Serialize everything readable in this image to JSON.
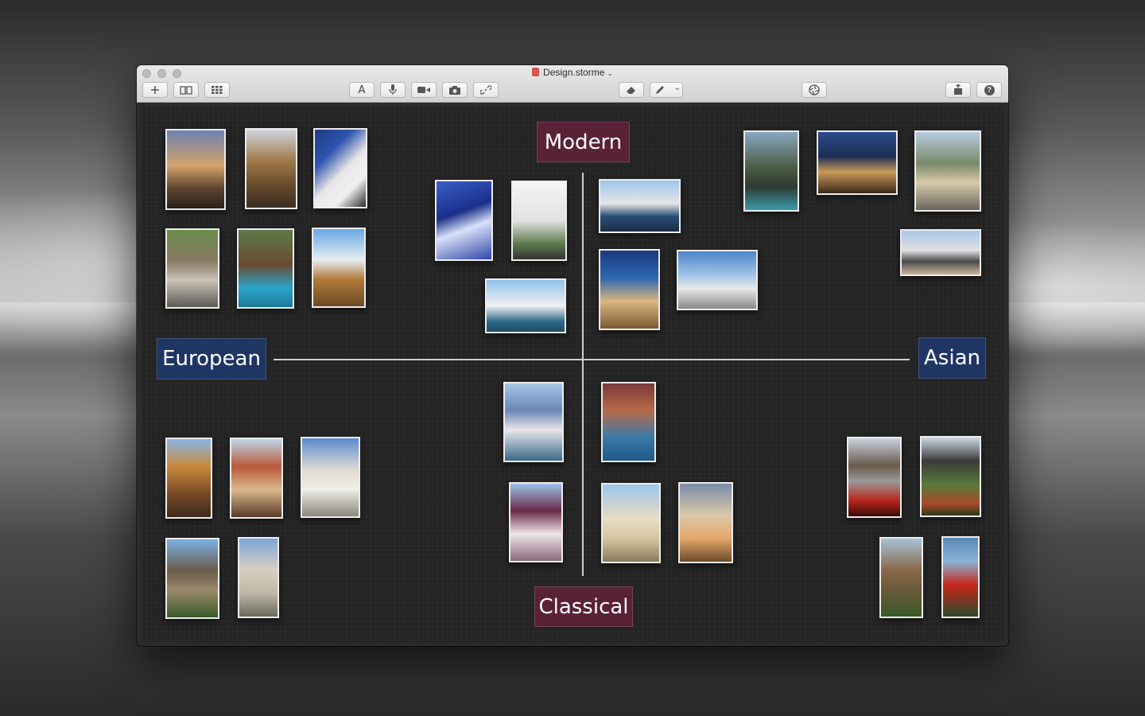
{
  "window": {
    "title": "Design.storme"
  },
  "toolbar": {
    "left": [
      {
        "name": "add-icon",
        "glyph": "+"
      },
      {
        "name": "book-icon",
        "glyph": ""
      },
      {
        "name": "grid-icon",
        "glyph": ""
      }
    ],
    "center": [
      {
        "name": "text-icon",
        "glyph": "A"
      },
      {
        "name": "microphone-icon",
        "glyph": ""
      },
      {
        "name": "video-icon",
        "glyph": ""
      },
      {
        "name": "camera-icon",
        "glyph": ""
      },
      {
        "name": "link-icon",
        "glyph": ""
      }
    ],
    "draw": [
      {
        "name": "eraser-icon"
      },
      {
        "name": "pencil-icon"
      },
      {
        "name": "chevron-down-icon"
      }
    ],
    "right": [
      {
        "name": "aperture-icon"
      },
      {
        "name": "share-icon"
      },
      {
        "name": "help-icon",
        "glyph": "?"
      }
    ]
  },
  "labels": {
    "modern": "Modern",
    "classical": "Classical",
    "european": "European",
    "asian": "Asian"
  },
  "colors": {
    "modern_classical_label": "#5a2237",
    "european_asian_label": "#1f3664"
  }
}
